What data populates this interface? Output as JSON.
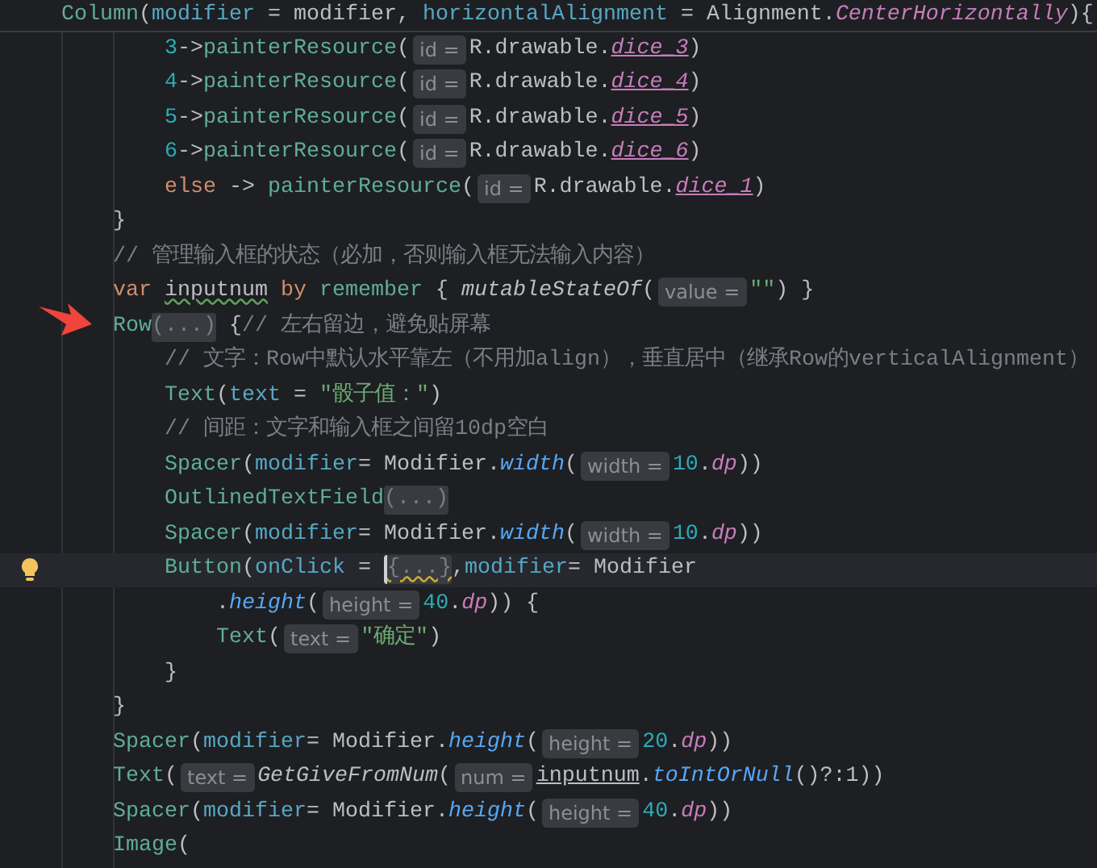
{
  "sticky_line": {
    "tokens": [
      {
        "text": "Column",
        "kind": "call"
      },
      {
        "text": "(",
        "kind": "plain"
      },
      {
        "text": "modifier",
        "kind": "arg"
      },
      {
        "text": " = modifier, ",
        "kind": "plain"
      },
      {
        "text": "horizontalAlignment",
        "kind": "arg"
      },
      {
        "text": " = Alignment.",
        "kind": "plain"
      },
      {
        "text": "CenterHorizontally",
        "kind": "const"
      },
      {
        "text": "){",
        "kind": "plain"
      }
    ]
  },
  "lines": [
    {
      "children": [
        {
          "current": false,
          "tokens": [
            {
              "text": "3",
              "kind": "number"
            },
            {
              "text": "->",
              "kind": "plain"
            },
            {
              "text": "painterResource",
              "kind": "call"
            },
            {
              "text": "(",
              "kind": "plain"
            },
            {
              "text": "id =",
              "kind": "hint"
            },
            {
              "text": "R.drawable.",
              "kind": "plain"
            },
            {
              "text": "dice_3",
              "kind": "res"
            },
            {
              "text": ")",
              "kind": "plain"
            }
          ]
        },
        {
          "current": false,
          "tokens": [
            {
              "text": "4",
              "kind": "number"
            },
            {
              "text": "->",
              "kind": "plain"
            },
            {
              "text": "painterResource",
              "kind": "call"
            },
            {
              "text": "(",
              "kind": "plain"
            },
            {
              "text": "id =",
              "kind": "hint"
            },
            {
              "text": "R.drawable.",
              "kind": "plain"
            },
            {
              "text": "dice_4",
              "kind": "res"
            },
            {
              "text": ")",
              "kind": "plain"
            }
          ]
        },
        {
          "current": false,
          "tokens": [
            {
              "text": "5",
              "kind": "number"
            },
            {
              "text": "->",
              "kind": "plain"
            },
            {
              "text": "painterResource",
              "kind": "call"
            },
            {
              "text": "(",
              "kind": "plain"
            },
            {
              "text": "id =",
              "kind": "hint"
            },
            {
              "text": "R.drawable.",
              "kind": "plain"
            },
            {
              "text": "dice_5",
              "kind": "res"
            },
            {
              "text": ")",
              "kind": "plain"
            }
          ]
        },
        {
          "current": false,
          "tokens": [
            {
              "text": "6",
              "kind": "number"
            },
            {
              "text": "->",
              "kind": "plain"
            },
            {
              "text": "painterResource",
              "kind": "call"
            },
            {
              "text": "(",
              "kind": "plain"
            },
            {
              "text": "id =",
              "kind": "hint"
            },
            {
              "text": "R.drawable.",
              "kind": "plain"
            },
            {
              "text": "dice_6",
              "kind": "res"
            },
            {
              "text": ")",
              "kind": "plain"
            }
          ]
        },
        {
          "current": false,
          "tokens": [
            {
              "text": "else",
              "kind": "keyword"
            },
            {
              "text": " -> ",
              "kind": "plain"
            },
            {
              "text": "painterResource",
              "kind": "call"
            },
            {
              "text": "(",
              "kind": "plain"
            },
            {
              "text": "id =",
              "kind": "hint"
            },
            {
              "text": "R.drawable.",
              "kind": "plain"
            },
            {
              "text": "dice_1",
              "kind": "res"
            },
            {
              "text": ")",
              "kind": "plain"
            }
          ]
        }
      ]
    },
    {
      "current": false,
      "tokens": [
        {
          "text": "}",
          "kind": "plain"
        }
      ]
    },
    {
      "current": false,
      "tokens": [
        {
          "text": "// 管理输入框的状态（必加，否则输入框无法输入内容）",
          "kind": "comment"
        }
      ]
    },
    {
      "current": false,
      "tokens": [
        {
          "text": "var ",
          "kind": "keyword"
        },
        {
          "text": "inputnum",
          "kind": "wavy"
        },
        {
          "text": " by ",
          "kind": "keyword"
        },
        {
          "text": "remember",
          "kind": "call"
        },
        {
          "text": " { ",
          "kind": "plain"
        },
        {
          "text": "mutableStateOf",
          "kind": "italic"
        },
        {
          "text": "(",
          "kind": "plain"
        },
        {
          "text": "value =",
          "kind": "hint"
        },
        {
          "text": "\"\"",
          "kind": "string"
        },
        {
          "text": ") }",
          "kind": "plain"
        }
      ]
    },
    {
      "current": false,
      "tokens": [
        {
          "text": "Row",
          "kind": "call"
        },
        {
          "text": "(...)",
          "kind": "fold"
        },
        {
          "text": " {",
          "kind": "plain"
        },
        {
          "text": "// 左右留边，避免贴屏幕",
          "kind": "comment"
        }
      ],
      "children": [
        {
          "current": false,
          "tokens": [
            {
              "text": "// 文字：Row中默认水平靠左（不用加align），垂直居中（继承Row的verticalAlignment）",
              "kind": "comment"
            }
          ]
        },
        {
          "current": false,
          "tokens": [
            {
              "text": "Text",
              "kind": "call"
            },
            {
              "text": "(",
              "kind": "plain"
            },
            {
              "text": "text",
              "kind": "arg"
            },
            {
              "text": " = ",
              "kind": "plain"
            },
            {
              "text": "\"骰子值：\"",
              "kind": "string"
            },
            {
              "text": ")",
              "kind": "plain"
            }
          ]
        },
        {
          "current": false,
          "tokens": [
            {
              "text": "// 间距：文字和输入框之间留10dp空白",
              "kind": "comment"
            }
          ]
        },
        {
          "current": false,
          "tokens": [
            {
              "text": "Spacer",
              "kind": "call"
            },
            {
              "text": "(",
              "kind": "plain"
            },
            {
              "text": "modifier",
              "kind": "arg"
            },
            {
              "text": "= Modifier.",
              "kind": "plain"
            },
            {
              "text": "width",
              "kind": "member"
            },
            {
              "text": "(",
              "kind": "plain"
            },
            {
              "text": "width =",
              "kind": "hint"
            },
            {
              "text": "10",
              "kind": "number"
            },
            {
              "text": ".",
              "kind": "plain"
            },
            {
              "text": "dp",
              "kind": "ext"
            },
            {
              "text": "))",
              "kind": "plain"
            }
          ]
        },
        {
          "current": false,
          "tokens": [
            {
              "text": "OutlinedTextField",
              "kind": "call"
            },
            {
              "text": "(...)",
              "kind": "fold"
            }
          ]
        },
        {
          "current": false,
          "tokens": [
            {
              "text": "Spacer",
              "kind": "call"
            },
            {
              "text": "(",
              "kind": "plain"
            },
            {
              "text": "modifier",
              "kind": "arg"
            },
            {
              "text": "= Modifier.",
              "kind": "plain"
            },
            {
              "text": "width",
              "kind": "member"
            },
            {
              "text": "(",
              "kind": "plain"
            },
            {
              "text": "width =",
              "kind": "hint"
            },
            {
              "text": "10",
              "kind": "number"
            },
            {
              "text": ".",
              "kind": "plain"
            },
            {
              "text": "dp",
              "kind": "ext"
            },
            {
              "text": "))",
              "kind": "plain"
            }
          ]
        },
        {
          "current": true,
          "tokens": [
            {
              "text": "Button",
              "kind": "call"
            },
            {
              "text": "(",
              "kind": "plain"
            },
            {
              "text": "onClick",
              "kind": "arg"
            },
            {
              "text": " = ",
              "kind": "plain"
            },
            {
              "text": "{...}",
              "kind": "fold-warn"
            },
            {
              "text": ",",
              "kind": "plain"
            },
            {
              "text": "modifier",
              "kind": "arg"
            },
            {
              "text": "= Modifier",
              "kind": "plain"
            }
          ],
          "children": [
            {
              "current": false,
              "tokens": [
                {
                  "text": ".",
                  "kind": "plain"
                },
                {
                  "text": "height",
                  "kind": "member"
                },
                {
                  "text": "(",
                  "kind": "plain"
                },
                {
                  "text": "height =",
                  "kind": "hint"
                },
                {
                  "text": "40",
                  "kind": "number"
                },
                {
                  "text": ".",
                  "kind": "plain"
                },
                {
                  "text": "dp",
                  "kind": "ext"
                },
                {
                  "text": ")) {",
                  "kind": "plain"
                }
              ]
            },
            {
              "current": false,
              "tokens": [
                {
                  "text": "Text",
                  "kind": "call"
                },
                {
                  "text": "(",
                  "kind": "plain"
                },
                {
                  "text": "text =",
                  "kind": "hint"
                },
                {
                  "text": "\"确定\"",
                  "kind": "string"
                },
                {
                  "text": ")",
                  "kind": "plain"
                }
              ]
            }
          ]
        },
        {
          "current": false,
          "tokens": [
            {
              "text": "}",
              "kind": "plain"
            }
          ]
        }
      ]
    },
    {
      "current": false,
      "tokens": [
        {
          "text": "}",
          "kind": "plain"
        }
      ]
    },
    {
      "current": false,
      "tokens": [
        {
          "text": "Spacer",
          "kind": "call"
        },
        {
          "text": "(",
          "kind": "plain"
        },
        {
          "text": "modifier",
          "kind": "arg"
        },
        {
          "text": "= Modifier.",
          "kind": "plain"
        },
        {
          "text": "height",
          "kind": "member"
        },
        {
          "text": "(",
          "kind": "plain"
        },
        {
          "text": "height =",
          "kind": "hint"
        },
        {
          "text": "20",
          "kind": "number"
        },
        {
          "text": ".",
          "kind": "plain"
        },
        {
          "text": "dp",
          "kind": "ext"
        },
        {
          "text": "))",
          "kind": "plain"
        }
      ]
    },
    {
      "current": false,
      "tokens": [
        {
          "text": "Text",
          "kind": "call"
        },
        {
          "text": "(",
          "kind": "plain"
        },
        {
          "text": "text =",
          "kind": "hint"
        },
        {
          "text": "GetGiveFromNum",
          "kind": "italic"
        },
        {
          "text": "(",
          "kind": "plain"
        },
        {
          "text": "num =",
          "kind": "hint"
        },
        {
          "text": "inputnum",
          "kind": "underline"
        },
        {
          "text": ".",
          "kind": "plain"
        },
        {
          "text": "toIntOrNull",
          "kind": "member"
        },
        {
          "text": "()?:1))",
          "kind": "plain"
        }
      ]
    },
    {
      "current": false,
      "tokens": [
        {
          "text": "Spacer",
          "kind": "call"
        },
        {
          "text": "(",
          "kind": "plain"
        },
        {
          "text": "modifier",
          "kind": "arg"
        },
        {
          "text": "= Modifier.",
          "kind": "plain"
        },
        {
          "text": "height",
          "kind": "member"
        },
        {
          "text": "(",
          "kind": "plain"
        },
        {
          "text": "height =",
          "kind": "hint"
        },
        {
          "text": "40",
          "kind": "number"
        },
        {
          "text": ".",
          "kind": "plain"
        },
        {
          "text": "dp",
          "kind": "ext"
        },
        {
          "text": "))",
          "kind": "plain"
        }
      ]
    },
    {
      "current": false,
      "tokens": [
        {
          "text": "Image",
          "kind": "call"
        },
        {
          "text": "(",
          "kind": "plain"
        }
      ]
    }
  ]
}
